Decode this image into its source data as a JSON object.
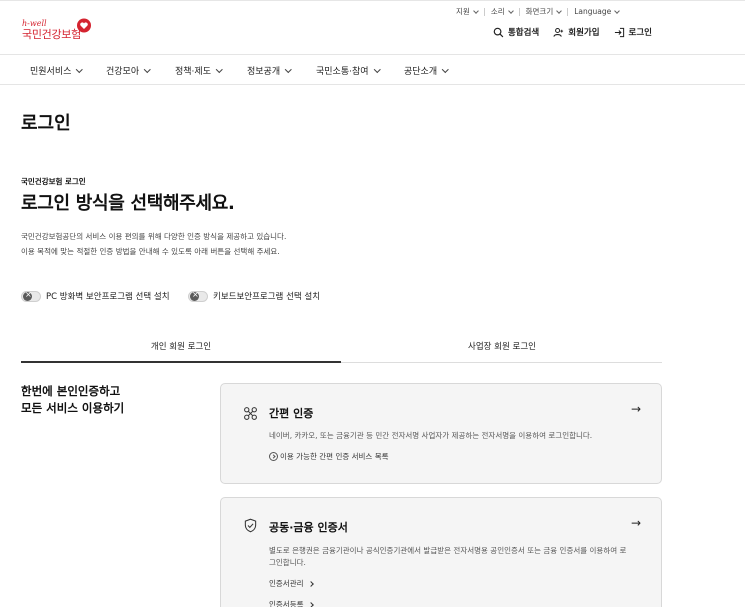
{
  "utility": {
    "items": [
      {
        "label": "지원"
      },
      {
        "label": "소리"
      },
      {
        "label": "화면크기"
      },
      {
        "label": "Language"
      }
    ]
  },
  "logo": {
    "brand": "h-well",
    "name": "국민건강보험"
  },
  "header_actions": {
    "search": "통합검색",
    "signup": "회원가입",
    "login": "로그인"
  },
  "gnb": {
    "menus": [
      {
        "label": "민원서비스"
      },
      {
        "label": "건강모아"
      },
      {
        "label": "정책·제도"
      },
      {
        "label": "정보공개"
      },
      {
        "label": "국민소통·참여"
      },
      {
        "label": "공단소개"
      }
    ]
  },
  "page": {
    "title": "로그인",
    "eyebrow": "국민건강보험 로그인",
    "heading": "로그인 방식을 선택해주세요.",
    "desc_line1": "국민건강보험공단의 서비스 이용 편의를 위해 다양한 인증 방식을 제공하고 있습니다.",
    "desc_line2": "이용 목적에 맞는 적절한 인증 방법을 안내해 수 있도록 아래 버튼을 선택해 주세요."
  },
  "toggles": [
    {
      "label": "PC 방화벽 보안프로그램 선택 설치",
      "on": false
    },
    {
      "label": "키보드보안프로그램 선택 설치",
      "on": false
    }
  ],
  "tabs": [
    {
      "label": "개인 회원 로그인",
      "active": true
    },
    {
      "label": "사업장 회원 로그인",
      "active": false
    }
  ],
  "promo": {
    "line1": "한번에 본인인증하고",
    "line2": "모든 서비스 이용하기"
  },
  "cards": [
    {
      "icon": "simple-auth-icon",
      "title": "간편 인증",
      "desc": "네이버, 카카오, 또는 금융기관 등 민간 전자서명 사업자가 제공하는 전자서명을 이용하여 로그인합니다.",
      "link": "이용 가능한 간편 인증 서비스 목록",
      "arrow": "→"
    },
    {
      "icon": "shield-check-icon",
      "title": "공동·금융 인증서",
      "desc": "별도로 은행권은 금융기관이나 공식인증기관에서 발급받은 전자서명용 공인인증서 또는 금융 인증서를 이용하여 로그인합니다.",
      "links": [
        "인증서관리",
        "인증서등록"
      ],
      "arrow": "→"
    }
  ],
  "colors": {
    "brand": "#d4232f",
    "card_bg": "#f5f5f5",
    "border": "#d8d8d8"
  }
}
